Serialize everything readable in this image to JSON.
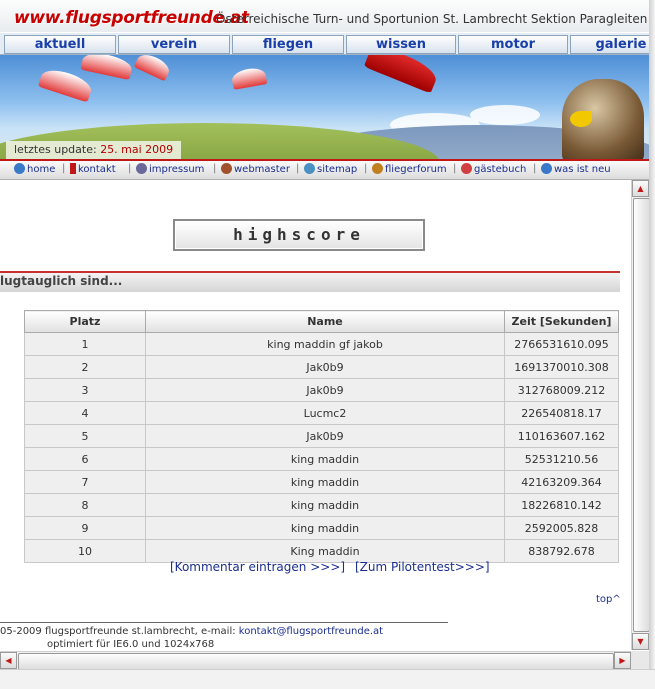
{
  "header": {
    "logo": "www.flugsportfreunde.at",
    "organization": "Österreichische Turn- und Sportunion St. Lambrecht Sektion Paragleiten (ZVR",
    "nav": [
      "aktuell",
      "verein",
      "fliegen",
      "wissen",
      "motor",
      "galerie"
    ],
    "update_label": "letztes update:",
    "update_date": "25. mai 2009"
  },
  "quicklinks": [
    "home",
    "kontakt",
    "impressum",
    "webmaster",
    "sitemap",
    "fliegerforum",
    "gästebuch",
    "was ist neu"
  ],
  "content": {
    "title": "highscore",
    "section": "lugtauglich sind...",
    "table": {
      "headers": [
        "Platz",
        "Name",
        "Zeit [Sekunden]"
      ],
      "rows": [
        [
          "1",
          "king maddin gf jakob",
          "2766531610.095"
        ],
        [
          "2",
          "Jak0b9",
          "1691370010.308"
        ],
        [
          "3",
          "Jak0b9",
          "312768009.212"
        ],
        [
          "4",
          "Lucmc2",
          "226540818.17"
        ],
        [
          "5",
          "Jak0b9",
          "110163607.162"
        ],
        [
          "6",
          "king maddin",
          "52531210.56"
        ],
        [
          "7",
          "king maddin",
          "42163209.364"
        ],
        [
          "8",
          "king maddin",
          "18226810.142"
        ],
        [
          "9",
          "king maddin",
          "2592005.828"
        ],
        [
          "10",
          "King maddin",
          "838792.678"
        ]
      ]
    },
    "link_comment": "[Kommentar eintragen >>>]",
    "link_pilot": "[Zum Pilotentest>>>]",
    "top": "top^"
  },
  "footer": {
    "line1": "05-2009 flugsportfreunde st.lambrecht, e-mail:",
    "email": "kontakt@flugsportfreunde.at",
    "line2": "optimiert für IE6.0 und 1024x768"
  },
  "colors": {
    "accent_red": "#c01818",
    "link_blue": "#1a2e8f",
    "nav_blue": "#1a3fa8"
  },
  "icons": [
    "globe-icon",
    "pen-icon",
    "people-icon",
    "person-icon",
    "sitemap-icon",
    "forum-icon",
    "book-icon",
    "new-icon",
    "eagle-image",
    "paraglider-image"
  ]
}
